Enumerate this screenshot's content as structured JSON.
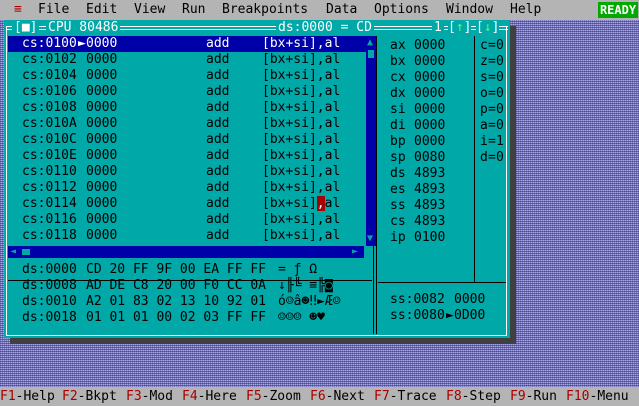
{
  "menubar": {
    "system": "≡",
    "items": [
      "File",
      "Edit",
      "View",
      "Run",
      "Breakpoints",
      "Data",
      "Options",
      "Window",
      "Help"
    ],
    "status": "READY"
  },
  "cpu_window": {
    "close_box": "[■]",
    "title": "CPU 80486",
    "ds_indicator": "ds:0000 = CD",
    "window_number": "1",
    "zoom_up": "↑",
    "zoom_down": "↓",
    "code": [
      {
        "addr": "cs:0100",
        "arrow": "►",
        "bytes": "0000",
        "op": "add",
        "args": "[bx+si],al"
      },
      {
        "addr": "cs:0102",
        "arrow": " ",
        "bytes": "0000",
        "op": "add",
        "args": "[bx+si],al"
      },
      {
        "addr": "cs:0104",
        "arrow": " ",
        "bytes": "0000",
        "op": "add",
        "args": "[bx+si],al"
      },
      {
        "addr": "cs:0106",
        "arrow": " ",
        "bytes": "0000",
        "op": "add",
        "args": "[bx+si],al"
      },
      {
        "addr": "cs:0108",
        "arrow": " ",
        "bytes": "0000",
        "op": "add",
        "args": "[bx+si],al"
      },
      {
        "addr": "cs:010A",
        "arrow": " ",
        "bytes": "0000",
        "op": "add",
        "args": "[bx+si],al"
      },
      {
        "addr": "cs:010C",
        "arrow": " ",
        "bytes": "0000",
        "op": "add",
        "args": "[bx+si],al"
      },
      {
        "addr": "cs:010E",
        "arrow": " ",
        "bytes": "0000",
        "op": "add",
        "args": "[bx+si],al"
      },
      {
        "addr": "cs:0110",
        "arrow": " ",
        "bytes": "0000",
        "op": "add",
        "args": "[bx+si],al"
      },
      {
        "addr": "cs:0112",
        "arrow": " ",
        "bytes": "0000",
        "op": "add",
        "args": "[bx+si],al"
      },
      {
        "addr": "cs:0114",
        "arrow": " ",
        "bytes": "0000",
        "op": "add",
        "args": "[bx+si],al"
      },
      {
        "addr": "cs:0116",
        "arrow": " ",
        "bytes": "0000",
        "op": "add",
        "args": "[bx+si],al"
      },
      {
        "addr": "cs:0118",
        "arrow": " ",
        "bytes": "0000",
        "op": "add",
        "args": "[bx+si],al"
      }
    ],
    "registers": [
      {
        "name": "ax",
        "value": "0000"
      },
      {
        "name": "bx",
        "value": "0000"
      },
      {
        "name": "cx",
        "value": "0000"
      },
      {
        "name": "dx",
        "value": "0000"
      },
      {
        "name": "si",
        "value": "0000"
      },
      {
        "name": "di",
        "value": "0000"
      },
      {
        "name": "bp",
        "value": "0000"
      },
      {
        "name": "sp",
        "value": "0080"
      },
      {
        "name": "ds",
        "value": "4893"
      },
      {
        "name": "es",
        "value": "4893"
      },
      {
        "name": "ss",
        "value": "4893"
      },
      {
        "name": "cs",
        "value": "4893"
      },
      {
        "name": "ip",
        "value": "0100"
      }
    ],
    "flags": [
      {
        "name": "c",
        "value": "0"
      },
      {
        "name": "z",
        "value": "0"
      },
      {
        "name": "s",
        "value": "0"
      },
      {
        "name": "o",
        "value": "0"
      },
      {
        "name": "p",
        "value": "0"
      },
      {
        "name": "a",
        "value": "0"
      },
      {
        "name": "i",
        "value": "1"
      },
      {
        "name": "d",
        "value": "0"
      }
    ],
    "dump": [
      {
        "addr": "ds:0000",
        "bytes": "CD 20 FF 9F 00 EA FF FF",
        "ascii": "= ƒ Ω"
      },
      {
        "addr": "ds:0008",
        "bytes": "AD DE C8 20 00 F0 CC 0A",
        "ascii": "↓╟╚ ≡╠◙"
      },
      {
        "addr": "ds:0010",
        "bytes": "A2 01 83 02 13 10 92 01",
        "ascii": "ó☺â☻‼►Æ☺"
      },
      {
        "addr": "ds:0018",
        "bytes": "01 01 01 00 02 03 FF FF",
        "ascii": "☺☺☺ ☻♥"
      }
    ],
    "stack": [
      {
        "addr": "ss:0082",
        "marker": " ",
        "value": "0000"
      },
      {
        "addr": "ss:0080",
        "marker": "►",
        "value": "0D00"
      }
    ]
  },
  "fkeys": [
    {
      "key": "F1",
      "label": "Help"
    },
    {
      "key": "F2",
      "label": "Bkpt"
    },
    {
      "key": "F3",
      "label": "Mod"
    },
    {
      "key": "F4",
      "label": "Here"
    },
    {
      "key": "F5",
      "label": "Zoom"
    },
    {
      "key": "F6",
      "label": "Next"
    },
    {
      "key": "F7",
      "label": "Trace"
    },
    {
      "key": "F8",
      "label": "Step"
    },
    {
      "key": "F9",
      "label": "Run"
    },
    {
      "key": "F10",
      "label": "Menu"
    }
  ]
}
